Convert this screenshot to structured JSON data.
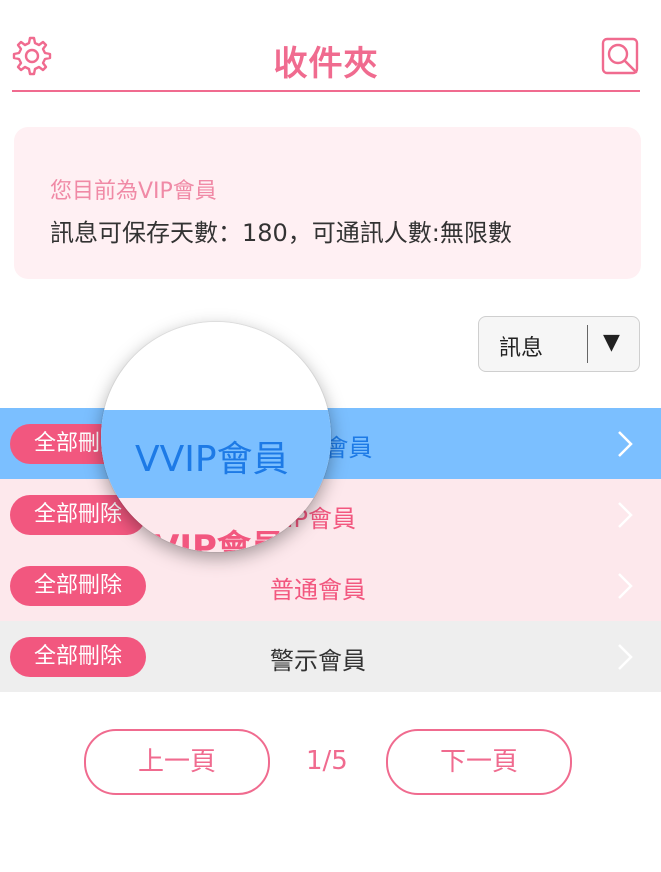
{
  "header": {
    "title": "收件夾"
  },
  "notice": {
    "line1": "您目前為VIP會員",
    "line2": "訊息可保存天數：180，可通訊人數:無限數"
  },
  "filter": {
    "selected": "訊息",
    "arrow": "▼"
  },
  "rows": [
    {
      "delete_label": "全部刪除",
      "label": "VVIP會員"
    },
    {
      "delete_label": "全部刪除",
      "label": "VIP會員"
    },
    {
      "delete_label": "全部刪除",
      "label": "普通會員"
    },
    {
      "delete_label": "全部刪除",
      "label": "警示會員"
    }
  ],
  "pager": {
    "prev_label": "上一頁",
    "page": "1/5",
    "next_label": "下一頁"
  },
  "magnifier": {
    "vvip_text": "VVIP會員",
    "vip_text": "VIP會員"
  },
  "colors": {
    "accent": "#f06b8f",
    "vvip_row": "#7bbfff",
    "vip_row": "#fde8ec",
    "warn_row": "#eeeeee",
    "delete_button": "#f2577f"
  },
  "icons": [
    "gear-icon",
    "search-icon",
    "chevron-right-icon",
    "dropdown-arrow-icon"
  ]
}
